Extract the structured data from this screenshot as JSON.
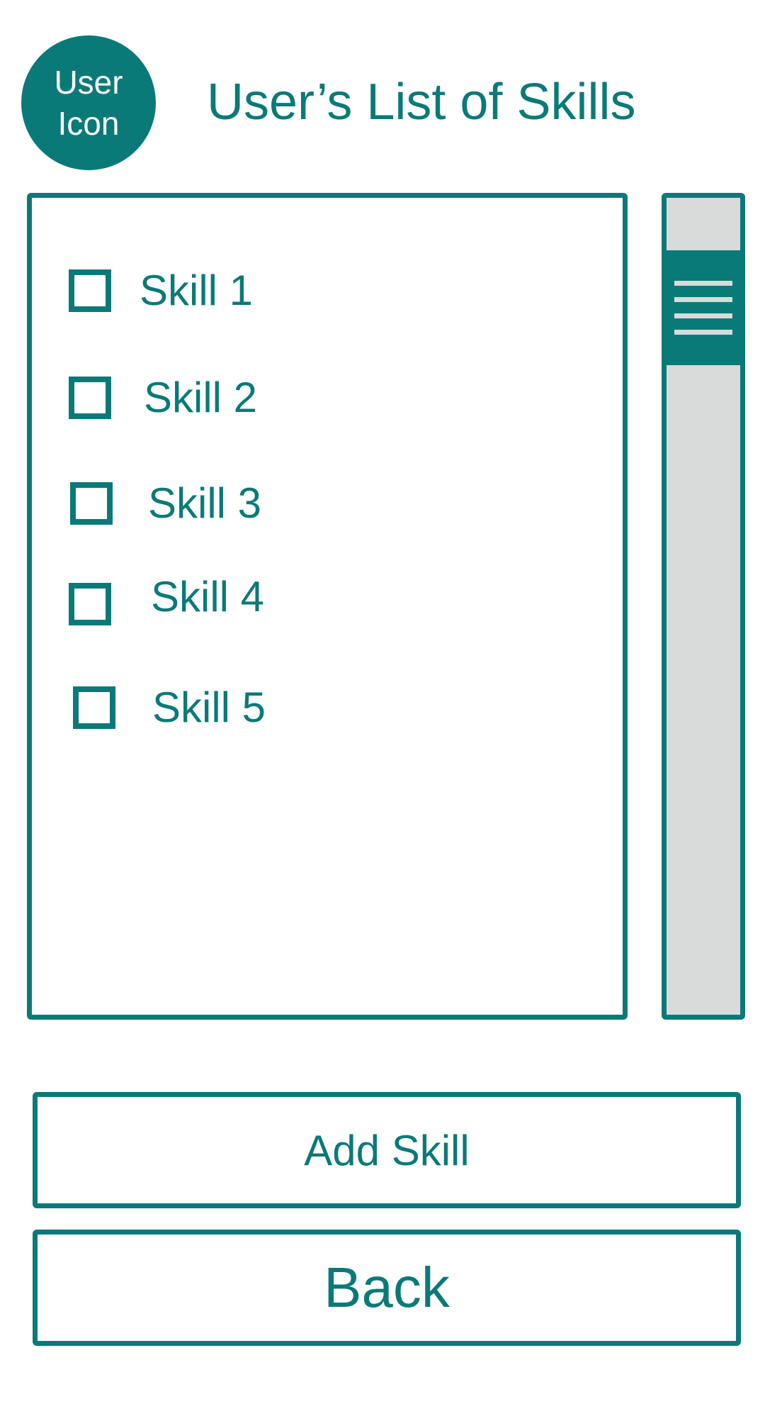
{
  "header": {
    "avatar_line1": "User",
    "avatar_line2": "Icon",
    "title": "User’s List of Skills"
  },
  "skills": [
    {
      "label": "Skill 1",
      "checked": false
    },
    {
      "label": "Skill 2",
      "checked": false
    },
    {
      "label": "Skill 3",
      "checked": false
    },
    {
      "label": "Skill 4",
      "checked": false
    },
    {
      "label": "Skill 5",
      "checked": false
    }
  ],
  "actions": {
    "add_label": "Add Skill",
    "back_label": "Back"
  },
  "icons": {
    "scroll_grip": "hamburger-grip-icon"
  },
  "colors": {
    "accent": "#0a7a78",
    "scroll_track": "#d9dada",
    "background": "#ffffff"
  }
}
